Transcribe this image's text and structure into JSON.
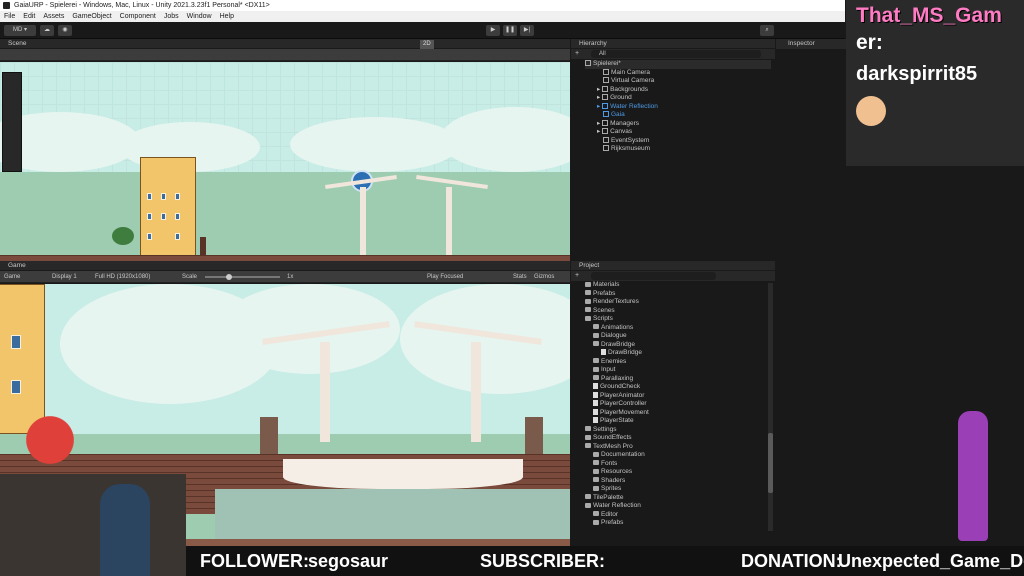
{
  "window": {
    "title": "GaiaURP - Spielerei - Windows, Mac, Linux - Unity 2021.3.23f1 Personal* <DX11>"
  },
  "menu": [
    "File",
    "Edit",
    "Assets",
    "GameObject",
    "Component",
    "Jobs",
    "Window",
    "Help"
  ],
  "toolbar": {
    "account": "MD"
  },
  "scene": {
    "tab": "Scene",
    "mode2d": "2D"
  },
  "game": {
    "tab": "Game",
    "view": "Game",
    "display": "Display 1",
    "resolution": "Full HD (1920x1080)",
    "scale_label": "Scale",
    "scale_value": "1x",
    "play_mode": "Play Focused",
    "stats": "Stats",
    "gizmos": "Gizmos"
  },
  "hierarchy": {
    "tab": "Hierarchy",
    "search": "All",
    "root": "Spielerei*",
    "items": [
      "Main Camera",
      "Virtual Camera",
      "Backgrounds",
      "Ground",
      "Water Reflection",
      "Gaia",
      "Managers",
      "Canvas",
      "EventSystem",
      "Rijksmuseum"
    ]
  },
  "inspector": {
    "tab": "Inspector"
  },
  "project": {
    "tab": "Project",
    "items": [
      {
        "label": "Materials",
        "indent": 1,
        "type": "folder"
      },
      {
        "label": "Prefabs",
        "indent": 1,
        "type": "folder"
      },
      {
        "label": "RenderTextures",
        "indent": 1,
        "type": "folder"
      },
      {
        "label": "Scenes",
        "indent": 1,
        "type": "folder"
      },
      {
        "label": "Scripts",
        "indent": 1,
        "type": "folder"
      },
      {
        "label": "Animations",
        "indent": 2,
        "type": "folder"
      },
      {
        "label": "Dialogue",
        "indent": 2,
        "type": "folder"
      },
      {
        "label": "DrawBridge",
        "indent": 2,
        "type": "folder"
      },
      {
        "label": "DrawBridge",
        "indent": 3,
        "type": "script"
      },
      {
        "label": "Enemies",
        "indent": 2,
        "type": "folder"
      },
      {
        "label": "Input",
        "indent": 2,
        "type": "folder"
      },
      {
        "label": "Parallaxing",
        "indent": 2,
        "type": "folder"
      },
      {
        "label": "GroundCheck",
        "indent": 2,
        "type": "script"
      },
      {
        "label": "PlayerAnimator",
        "indent": 2,
        "type": "script"
      },
      {
        "label": "PlayerController",
        "indent": 2,
        "type": "script"
      },
      {
        "label": "PlayerMovement",
        "indent": 2,
        "type": "script"
      },
      {
        "label": "PlayerState",
        "indent": 2,
        "type": "script"
      },
      {
        "label": "Settings",
        "indent": 1,
        "type": "folder"
      },
      {
        "label": "SoundEffects",
        "indent": 1,
        "type": "folder"
      },
      {
        "label": "TextMesh Pro",
        "indent": 1,
        "type": "folder"
      },
      {
        "label": "Documentation",
        "indent": 2,
        "type": "folder"
      },
      {
        "label": "Fonts",
        "indent": 2,
        "type": "folder"
      },
      {
        "label": "Resources",
        "indent": 2,
        "type": "folder"
      },
      {
        "label": "Shaders",
        "indent": 2,
        "type": "folder"
      },
      {
        "label": "Sprites",
        "indent": 2,
        "type": "folder"
      },
      {
        "label": "TilePalette",
        "indent": 1,
        "type": "folder"
      },
      {
        "label": "Water Reflection",
        "indent": 1,
        "type": "folder"
      },
      {
        "label": "Editor",
        "indent": 2,
        "type": "folder"
      },
      {
        "label": "Prefabs",
        "indent": 2,
        "type": "folder"
      }
    ]
  },
  "overlay": {
    "name_line1": "That_MS_Gam",
    "name_line2": "er:",
    "name_line3": "darkspirrit85",
    "follower_label": "FOLLOWER:",
    "follower_value": "segosaur",
    "subscriber_label": "SUBSCRIBER:",
    "donation_label": "DONATION:",
    "donation_value": "Unexpected_Game_De"
  },
  "colors": {
    "accent_blue": "#4d9be6",
    "overlay_pink": "#ff7bc3",
    "sky": "#c8ece6"
  }
}
